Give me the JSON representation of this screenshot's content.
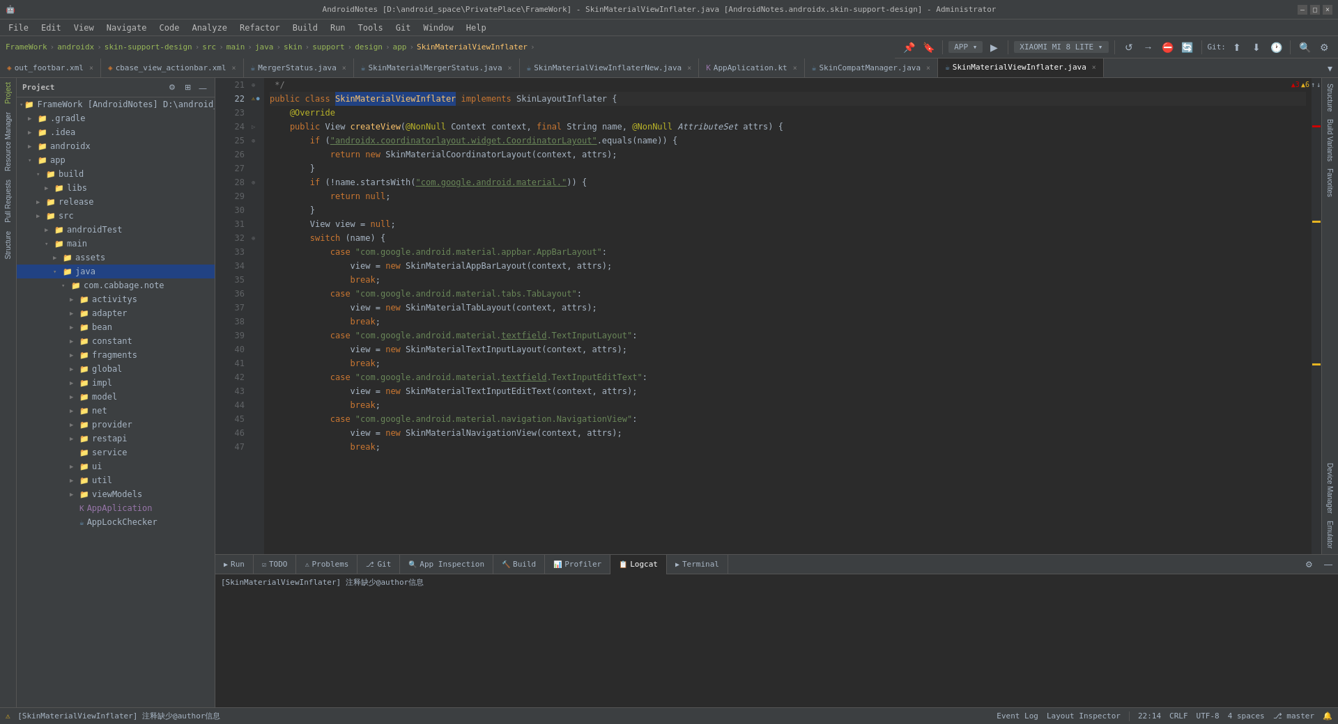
{
  "titleBar": {
    "title": "AndroidNotes [D:\\android_space\\PrivatePlace\\FrameWork] - SkinMaterialViewInflater.java [AndroidNotes.androidx.skin-support-design] - Administrator",
    "controls": [
      "—",
      "□",
      "×"
    ]
  },
  "menuBar": {
    "items": [
      "File",
      "Edit",
      "View",
      "Navigate",
      "Code",
      "Analyze",
      "Refactor",
      "Build",
      "Run",
      "Tools",
      "Git",
      "Window",
      "Help"
    ]
  },
  "breadcrumb": {
    "items": [
      "FrameWork",
      "androidx",
      "skin-support-design",
      "src",
      "main",
      "java",
      "skin",
      "support",
      "design",
      "app",
      "SkinMaterialViewInflater"
    ]
  },
  "toolbar": {
    "appLabel": "APP",
    "deviceLabel": "XIAOMI MI 8 LITE",
    "gitLabel": "Git:"
  },
  "tabs": [
    {
      "label": "out_footbar.xml",
      "icon": "xml",
      "active": false
    },
    {
      "label": "cbase_view_actionbar.xml",
      "icon": "xml",
      "active": false
    },
    {
      "label": "MergerStatus.java",
      "icon": "java",
      "active": false
    },
    {
      "label": "SkinMaterialMergerStatus.java",
      "icon": "java",
      "active": false
    },
    {
      "label": "SkinMaterialViewInflaterNew.java",
      "icon": "java",
      "active": false
    },
    {
      "label": "AppAplication.kt",
      "icon": "kt",
      "active": false
    },
    {
      "label": "SkinCompatManager.java",
      "icon": "java",
      "active": false
    },
    {
      "label": "SkinMaterialViewInflater.java",
      "icon": "java",
      "active": true
    }
  ],
  "projectPanel": {
    "title": "Project",
    "rootLabel": "FrameWork [AndroidNotes] D:\\android_space\\PrivatePla...",
    "tree": [
      {
        "level": 1,
        "label": ".gradle",
        "type": "folder",
        "expanded": false
      },
      {
        "level": 1,
        "label": ".idea",
        "type": "folder",
        "expanded": false
      },
      {
        "level": 1,
        "label": "androidx",
        "type": "folder",
        "expanded": false
      },
      {
        "level": 1,
        "label": "app",
        "type": "folder",
        "expanded": true
      },
      {
        "level": 2,
        "label": "build",
        "type": "folder",
        "expanded": true
      },
      {
        "level": 3,
        "label": "libs",
        "type": "folder",
        "expanded": false
      },
      {
        "level": 2,
        "label": "release",
        "type": "folder",
        "expanded": false
      },
      {
        "level": 2,
        "label": "src",
        "type": "folder",
        "expanded": false
      },
      {
        "level": 3,
        "label": "androidTest",
        "type": "folder",
        "expanded": false
      },
      {
        "level": 3,
        "label": "main",
        "type": "folder",
        "expanded": true
      },
      {
        "level": 4,
        "label": "assets",
        "type": "folder",
        "expanded": false
      },
      {
        "level": 4,
        "label": "java",
        "type": "folder",
        "expanded": true,
        "highlighted": true
      },
      {
        "level": 5,
        "label": "com.cabbage.note",
        "type": "folder",
        "expanded": true
      },
      {
        "level": 6,
        "label": "activitys",
        "type": "folder",
        "expanded": false
      },
      {
        "level": 6,
        "label": "adapter",
        "type": "folder",
        "expanded": false
      },
      {
        "level": 6,
        "label": "bean",
        "type": "folder",
        "expanded": false
      },
      {
        "level": 6,
        "label": "constant",
        "type": "folder",
        "expanded": false
      },
      {
        "level": 6,
        "label": "fragments",
        "type": "folder",
        "expanded": false
      },
      {
        "level": 6,
        "label": "global",
        "type": "folder",
        "expanded": false
      },
      {
        "level": 6,
        "label": "impl",
        "type": "folder",
        "expanded": false
      },
      {
        "level": 6,
        "label": "model",
        "type": "folder",
        "expanded": false
      },
      {
        "level": 6,
        "label": "net",
        "type": "folder",
        "expanded": false
      },
      {
        "level": 6,
        "label": "provider",
        "type": "folder",
        "expanded": false
      },
      {
        "level": 6,
        "label": "restapi",
        "type": "folder",
        "expanded": false
      },
      {
        "level": 6,
        "label": "service",
        "type": "folder",
        "expanded": false
      },
      {
        "level": 6,
        "label": "ui",
        "type": "folder",
        "expanded": false
      },
      {
        "level": 6,
        "label": "util",
        "type": "folder",
        "expanded": false
      },
      {
        "level": 6,
        "label": "viewModels",
        "type": "folder",
        "expanded": false
      },
      {
        "level": 6,
        "label": "AppAplication",
        "type": "kotlin",
        "expanded": false
      },
      {
        "level": 6,
        "label": "AppLockChecker",
        "type": "java",
        "expanded": false
      }
    ]
  },
  "codeLines": [
    {
      "num": 21,
      "content": " */",
      "type": "comment"
    },
    {
      "num": 22,
      "content": "public class SkinMaterialViewInflater implements SkinLayoutInflater {",
      "type": "code",
      "highlight": "SkinMaterialViewInflater"
    },
    {
      "num": 23,
      "content": "    @Override",
      "type": "annotation"
    },
    {
      "num": 24,
      "content": "    public View createView(@NonNull Context context, final String name, @NonNull AttributeSet attrs) {",
      "type": "code"
    },
    {
      "num": 25,
      "content": "        if (\"androidx.coordinatorlayout.widget.CoordinatorLayout\".equals(name)) {",
      "type": "code"
    },
    {
      "num": 26,
      "content": "            return new SkinMaterialCoordinatorLayout(context, attrs);",
      "type": "code"
    },
    {
      "num": 27,
      "content": "        }",
      "type": "code"
    },
    {
      "num": 28,
      "content": "        if (!name.startsWith(\"com.google.android.material.\")) {",
      "type": "code"
    },
    {
      "num": 29,
      "content": "            return null;",
      "type": "code"
    },
    {
      "num": 30,
      "content": "        }",
      "type": "code"
    },
    {
      "num": 31,
      "content": "        View view = null;",
      "type": "code"
    },
    {
      "num": 32,
      "content": "        switch (name) {",
      "type": "code"
    },
    {
      "num": 33,
      "content": "            case \"com.google.android.material.appbar.AppBarLayout\":",
      "type": "code"
    },
    {
      "num": 34,
      "content": "                view = new SkinMaterialAppBarLayout(context, attrs);",
      "type": "code"
    },
    {
      "num": 35,
      "content": "                break;",
      "type": "code"
    },
    {
      "num": 36,
      "content": "            case \"com.google.android.material.tabs.TabLayout\":",
      "type": "code"
    },
    {
      "num": 37,
      "content": "                view = new SkinMaterialTabLayout(context, attrs);",
      "type": "code"
    },
    {
      "num": 38,
      "content": "                break;",
      "type": "code"
    },
    {
      "num": 39,
      "content": "            case \"com.google.android.material.textfield.TextInputLayout\":",
      "type": "code"
    },
    {
      "num": 40,
      "content": "                view = new SkinMaterialTextInputLayout(context, attrs);",
      "type": "code"
    },
    {
      "num": 41,
      "content": "                break;",
      "type": "code"
    },
    {
      "num": 42,
      "content": "            case \"com.google.android.material.textfield.TextInputEditText\":",
      "type": "code"
    },
    {
      "num": 43,
      "content": "                view = new SkinMaterialTextInputEditText(context, attrs);",
      "type": "code"
    },
    {
      "num": 44,
      "content": "                break;",
      "type": "code"
    },
    {
      "num": 45,
      "content": "            case \"com.google.android.material.navigation.NavigationView\":",
      "type": "code"
    },
    {
      "num": 46,
      "content": "                view = new SkinMaterialNavigationView(context, attrs);",
      "type": "code"
    },
    {
      "num": 47,
      "content": "                break;",
      "type": "code"
    }
  ],
  "bottomTabs": [
    {
      "label": "Run",
      "icon": "▶",
      "active": false
    },
    {
      "label": "TODO",
      "icon": "☑",
      "active": false
    },
    {
      "label": "Problems",
      "icon": "⚠",
      "active": false
    },
    {
      "label": "Git",
      "icon": "⎇",
      "active": false
    },
    {
      "label": "App Inspection",
      "icon": "🔍",
      "active": false
    },
    {
      "label": "Build",
      "icon": "🔨",
      "active": false
    },
    {
      "label": "Profiler",
      "icon": "📊",
      "active": false
    },
    {
      "label": "Logcat",
      "icon": "📋",
      "active": true
    },
    {
      "label": "Terminal",
      "icon": "▶",
      "active": false
    }
  ],
  "logcatContent": "[SkinMaterialViewInflater] 注释缺少@author信息",
  "statusBar": {
    "left": "[SkinMaterialViewInflater] 注释缺少@author信息",
    "line": "22:14",
    "encoding": "CRLF",
    "charset": "UTF-8",
    "indent": "4 spaces",
    "right1": "Event Log",
    "right2": "Layout Inspector"
  },
  "rightSideTools": [
    "Structure",
    "Build Variants",
    "Favorites"
  ],
  "leftSideTools": [
    "Project",
    "Resource Manager",
    "Pull Requests",
    "Structure"
  ]
}
